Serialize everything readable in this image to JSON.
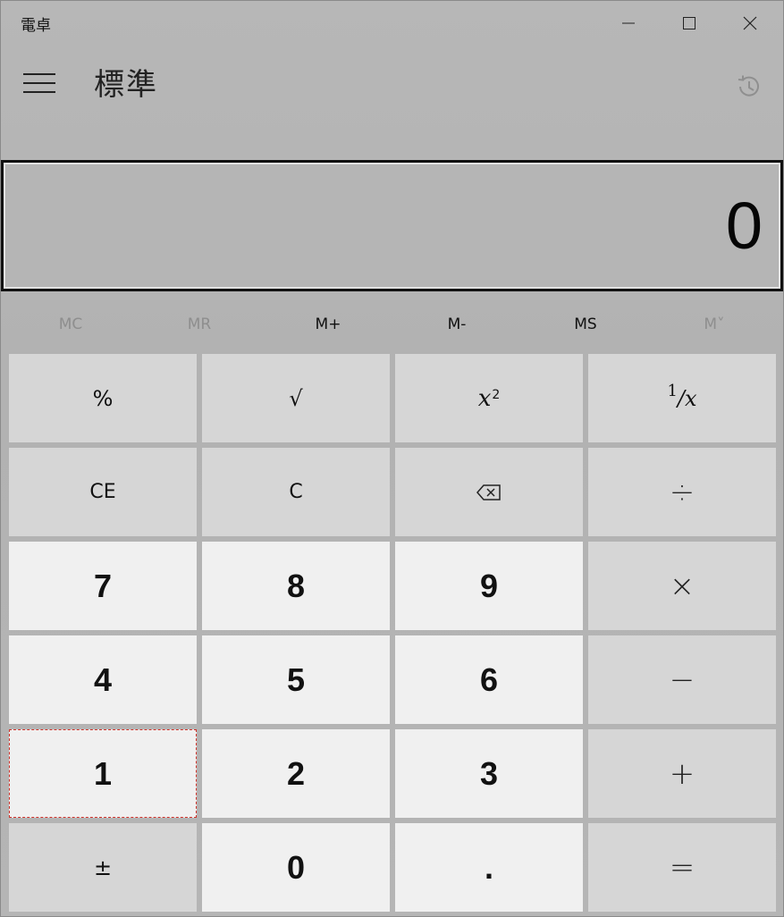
{
  "window": {
    "title": "電卓",
    "controls": [
      "minimize",
      "maximize",
      "close"
    ]
  },
  "header": {
    "mode": "標準"
  },
  "display": {
    "value": "0"
  },
  "memory": [
    {
      "label": "MC",
      "enabled": false
    },
    {
      "label": "MR",
      "enabled": false
    },
    {
      "label": "M+",
      "enabled": true
    },
    {
      "label": "M-",
      "enabled": true
    },
    {
      "label": "MS",
      "enabled": true
    },
    {
      "label": "M˅",
      "enabled": false
    }
  ],
  "keys": {
    "percent": "%",
    "sqrt": "√",
    "square_base": "x",
    "square_exp": "2",
    "recip_num": "1",
    "recip_den": "/x",
    "ce": "CE",
    "c": "C",
    "divide": "÷",
    "seven": "7",
    "eight": "8",
    "nine": "9",
    "multiply": "×",
    "four": "4",
    "five": "5",
    "six": "6",
    "minus": "−",
    "one": "1",
    "two": "2",
    "three": "3",
    "plus": "+",
    "negate": "±",
    "zero": "0",
    "decimal": ".",
    "equals": "="
  },
  "colors": {
    "background": "#b5b5b5",
    "function_key": "#d6d6d6",
    "number_key": "#f0f0f0",
    "focus_outline": "#d0342c"
  },
  "icons": [
    "hamburger-icon",
    "history-icon",
    "backspace-icon",
    "minimize-icon",
    "maximize-icon",
    "close-icon"
  ]
}
